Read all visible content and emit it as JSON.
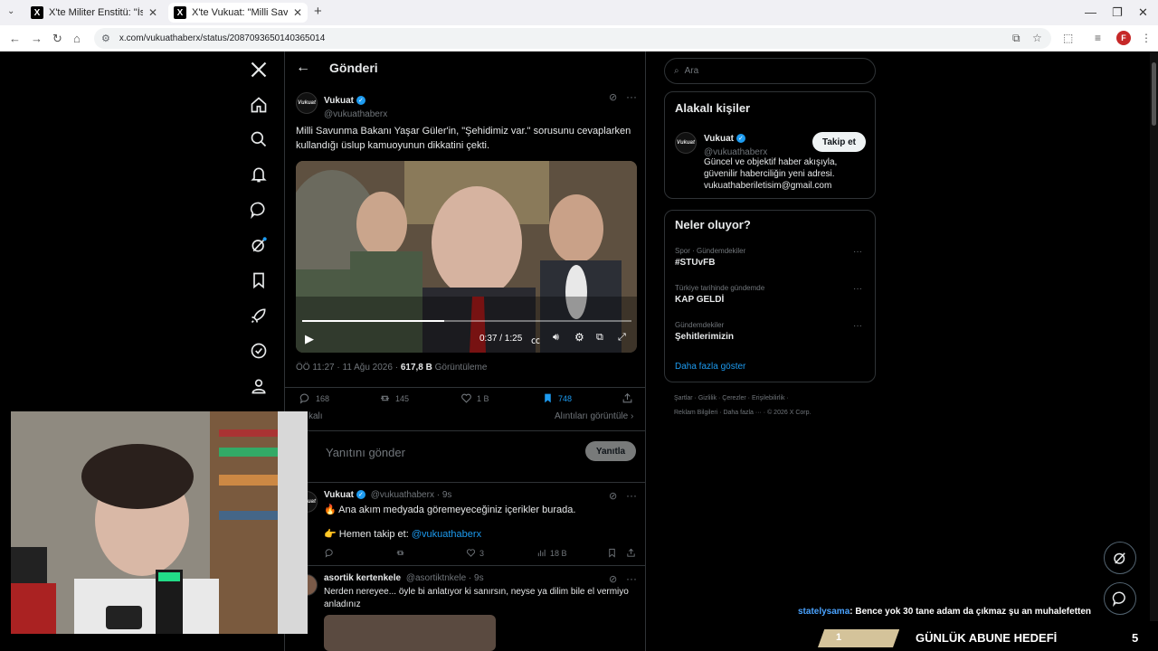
{
  "browser": {
    "tabs": [
      {
        "title": "X'te Militer Enstitü: \"İstanbul'da",
        "active": false
      },
      {
        "title": "X'te Vukuat: \"Milli Savunma Bak",
        "active": true
      }
    ],
    "new_tab": "+",
    "url": "x.com/vukuathaberx/status/2087093650140365014",
    "profile_initial": "F"
  },
  "header": {
    "title": "Gönderi"
  },
  "post": {
    "author_name": "Vukuat",
    "author_handle": "@vukuathaberx",
    "avatar_text": "Vukuat",
    "text": "Milli Savunma Bakanı Yaşar Güler'in, \"Şehidimiz var.\" sorusunu cevaplarken kullandığı üslup kamuoyunun dikkatini çekti.",
    "video_time": "0:37 / 1:25",
    "video_progress": 0.43,
    "timestamp": "ÖÖ 11:27 · 11 Ağu 2026 ·",
    "views_count": "617,8 B",
    "views_label": "Görüntüleme",
    "replies": "168",
    "reposts": "145",
    "likes": "1 B",
    "bookmarks": "748"
  },
  "sort": {
    "left": "kalı",
    "right": "Alıntıları görüntüle"
  },
  "reply_box": {
    "placeholder": "Yanıtını gönder",
    "button": "Yanıtla"
  },
  "replies": [
    {
      "name": "Vukuat",
      "handle": "@vukuathaberx · 9s",
      "line1": "🔥 Ana akım medyada göremeyeceğiniz içerikler burada.",
      "line2_prefix": "👉 Hemen takip et:",
      "line2_link": "@vukuathaberx",
      "likes": "3",
      "views": "18 B"
    },
    {
      "name": "asortik kertenkele",
      "handle": "@asortiktnkele · 9s",
      "text": "Nerden nereyee... öyle bi anlatıyor ki sanırsın, neyse ya dilim bile el vermiyo anladınız"
    }
  ],
  "search": {
    "placeholder": "Ara"
  },
  "related": {
    "title": "Alakalı kişiler",
    "name": "Vukuat",
    "handle": "@vukuathaberx",
    "follow": "Takip et",
    "bio": [
      "Güncel ve objektif haber akışıyla,",
      "güvenilir haberciliğin yeni adresi.",
      "vukuathaberiletisim@gmail.com"
    ]
  },
  "trends": {
    "title": "Neler oluyor?",
    "items": [
      {
        "category": "Spor · Gündemdekiler",
        "name": "#STUvFB"
      },
      {
        "category": "Türkiye tarihinde gündemde",
        "name": "KAP GELDİ"
      },
      {
        "category": "Gündemdekiler",
        "name": "Şehitlerimizin"
      }
    ],
    "show_more": "Daha fazla göster"
  },
  "footer": {
    "line1": "Şartlar  ·  Gizlilik  ·  Çerezler  ·  Erişilebilirlik  ·",
    "line2": "Reklam Bilgileri  ·  Daha fazla ···  ·  © 2026 X Corp."
  },
  "overlay": {
    "chat_user": "statelysama",
    "chat_message": ": Bence yok 30 tane adam da çıkmaz şu an muhalefetten",
    "goal_current": "1",
    "goal_label": "GÜNLÜK ABUNE HEDEFİ",
    "goal_target": "5",
    "goal_fraction": 0.2
  },
  "colors": {
    "accent": "#1d9bf0",
    "bookmark": "#1d9bf0",
    "chat_user": "#4aa3ff",
    "goal": "#d4c39a"
  }
}
